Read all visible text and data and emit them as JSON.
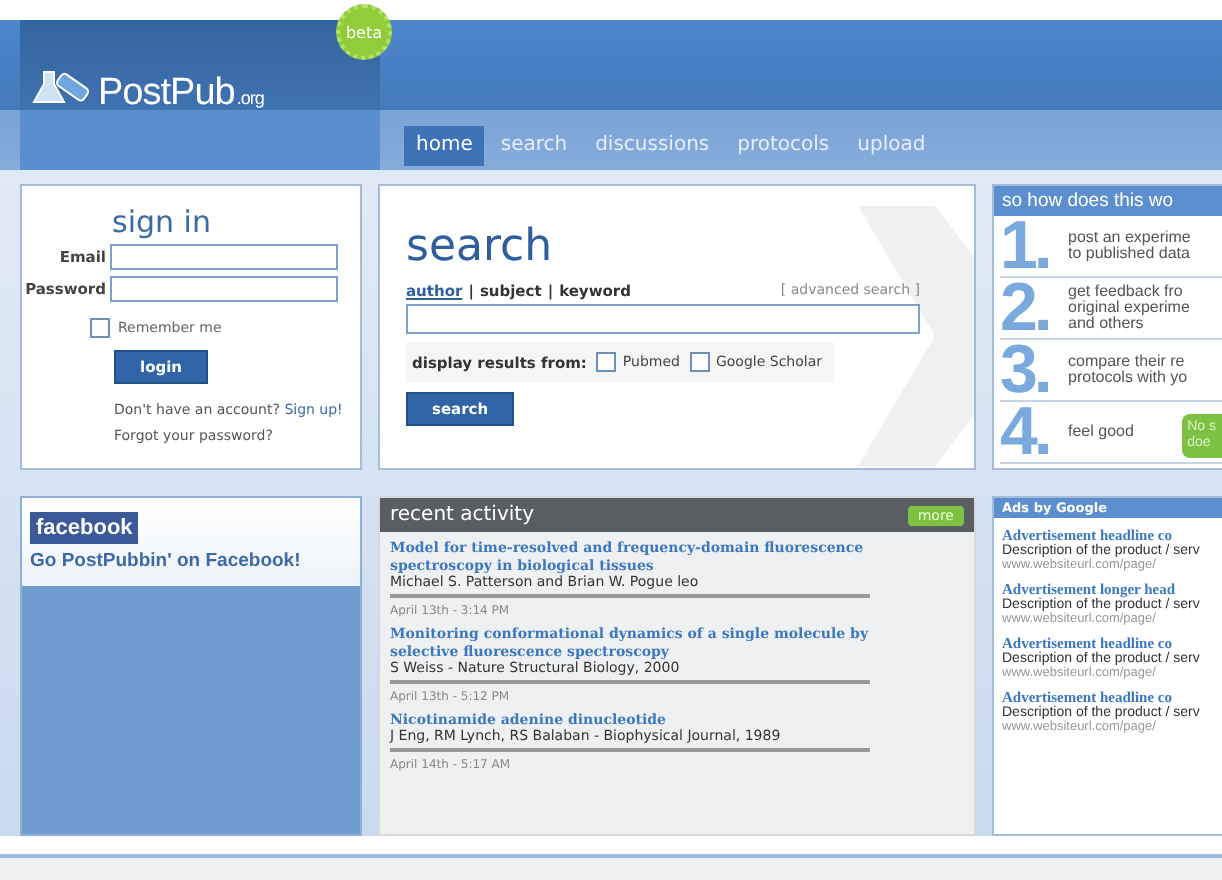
{
  "header": {
    "logo": "PostPub",
    "logo_suffix": ".org",
    "badge": "beta"
  },
  "nav": [
    {
      "label": "home",
      "selected": true
    },
    {
      "label": "search",
      "selected": false
    },
    {
      "label": "discussions",
      "selected": false
    },
    {
      "label": "protocols",
      "selected": false
    },
    {
      "label": "upload",
      "selected": false
    }
  ],
  "sign_in": {
    "title": "sign in",
    "email_label": "Email",
    "password_label": "Password",
    "remember": {
      "label": "Remember me",
      "checked": false
    },
    "button": "login",
    "signup_text": "Don't have an account?",
    "signup_link": "Sign up!",
    "forgot": "Forgot your password?"
  },
  "search": {
    "title": "search",
    "modes": [
      {
        "label": "author",
        "selected": true
      },
      {
        "label": "subject",
        "selected": false
      },
      {
        "label": "keyword",
        "selected": false
      }
    ],
    "separator": "|",
    "advanced": "[ advanced search ]",
    "display_label": "display results from:",
    "sources": [
      {
        "label": "Pubmed",
        "checked": false
      },
      {
        "label": "Google Scholar",
        "checked": false
      }
    ],
    "button": "search"
  },
  "how": {
    "title": "so how does this wo",
    "steps": [
      {
        "number": "1.",
        "lines": [
          "post an experime",
          "to published data"
        ]
      },
      {
        "number": "2.",
        "lines": [
          "get feedback fro",
          "original experime",
          "and others"
        ]
      },
      {
        "number": "3.",
        "lines": [
          "compare their re",
          "protocols with yo"
        ]
      },
      {
        "number": "4.",
        "lines": [
          "feel good"
        ]
      }
    ],
    "badge": [
      "No s",
      "doe"
    ]
  },
  "facebook": {
    "logo": "facebook",
    "text": "Go PostPubbin' on Facebook!"
  },
  "recent": {
    "title": "recent activity",
    "more": "more",
    "items": [
      {
        "title": "Model for time-resolved and frequency-domain fluorescence spectroscopy in biological tissues",
        "authors": "Michael S. Patterson and Brian W. Pogue leo",
        "time": "April 13th - 3:14 PM"
      },
      {
        "title": "Monitoring conformational dynamics of a single molecule by selective fluorescence spectroscopy",
        "authors": "S Weiss - Nature Structural Biology, 2000",
        "time": "April 13th - 5:12 PM"
      },
      {
        "title": "Nicotinamide adenine dinucleotide",
        "authors": "J Eng, RM Lynch, RS Balaban - Biophysical Journal, 1989",
        "time": "April 14th - 5:17 AM"
      }
    ]
  },
  "ads": {
    "title": "Ads by Google",
    "items": [
      {
        "headline": "Advertisement headline co",
        "description": "Description of the product / serv",
        "url": "www.websiteurl.com/page/"
      },
      {
        "headline": "Advertisement longer head",
        "description": "Description of the product / serv",
        "url": "www.websiteurl.com/page/"
      },
      {
        "headline": "Advertisement headline co",
        "description": "Description of the product / serv",
        "url": "www.websiteurl.com/page/"
      },
      {
        "headline": "Advertisement headline co",
        "description": "Description of the product / serv",
        "url": "www.websiteurl.com/page/"
      }
    ]
  }
}
